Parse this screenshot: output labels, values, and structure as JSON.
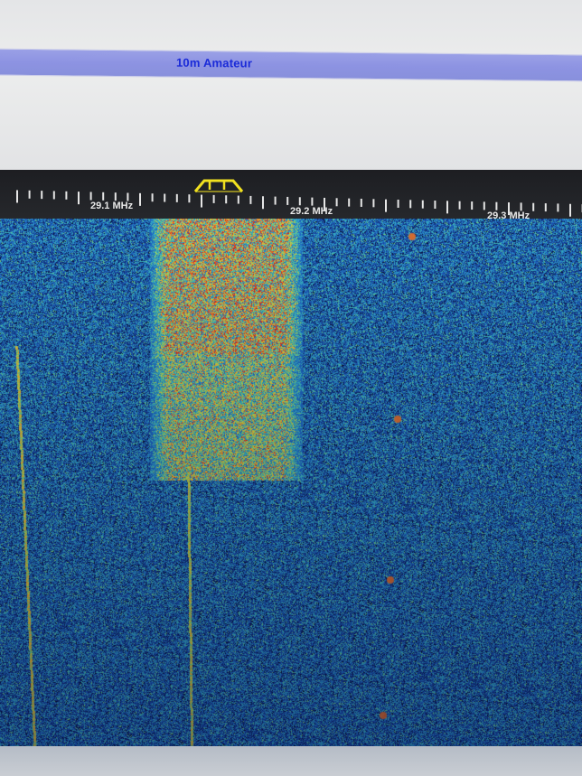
{
  "band": {
    "label": "10m Amateur"
  },
  "scale": {
    "labels": [
      "29.1 MHz",
      "29.2 MHz",
      "29.3 MHz"
    ],
    "filter_marker": "passband-marker"
  },
  "waterfall": {
    "signals": [
      {
        "name": "wideband-signal",
        "description": ""
      },
      {
        "name": "carrier-trace",
        "description": ""
      }
    ]
  },
  "colors": {
    "band_bar": "#8d93e2",
    "band_text": "#1a2ad8",
    "scale_bg": "#1f2024",
    "marker": "#f0e020",
    "waterfall_bg": "#1d4c9a",
    "hot": "#e0402a",
    "warm": "#e8c43a"
  }
}
